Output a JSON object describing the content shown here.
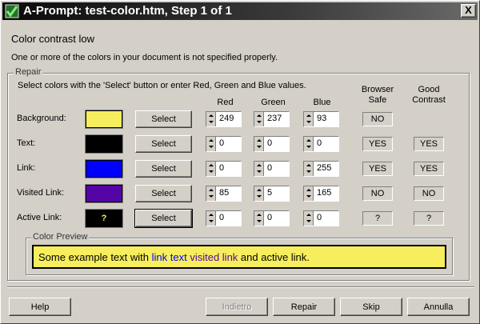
{
  "window": {
    "title": "A-Prompt: test-color.htm, Step 1 of 1",
    "close_glyph": "X"
  },
  "heading": "Color contrast low",
  "subtext": "One or more of the colors in your document is not specified properly.",
  "repair_group": {
    "label": "Repair",
    "instruction": "Select colors with the 'Select' button or enter Red, Green and Blue values.",
    "columns": {
      "red": "Red",
      "green": "Green",
      "blue": "Blue",
      "browser_safe": "Browser Safe",
      "good_contrast": "Good Contrast"
    },
    "rows": [
      {
        "label": "Background:",
        "swatch_color": "#f7ee5d",
        "swatch_text": "",
        "select_label": "Select",
        "red": "249",
        "green": "237",
        "blue": "93",
        "browser_safe": "NO",
        "good_contrast": ""
      },
      {
        "label": "Text:",
        "swatch_color": "#000000",
        "swatch_text": "",
        "select_label": "Select",
        "red": "0",
        "green": "0",
        "blue": "0",
        "browser_safe": "YES",
        "good_contrast": "YES"
      },
      {
        "label": "Link:",
        "swatch_color": "#0000ff",
        "swatch_text": "",
        "select_label": "Select",
        "red": "0",
        "green": "0",
        "blue": "255",
        "browser_safe": "YES",
        "good_contrast": "YES"
      },
      {
        "label": "Visited Link:",
        "swatch_color": "#5505a5",
        "swatch_text": "",
        "select_label": "Select",
        "red": "85",
        "green": "5",
        "blue": "165",
        "browser_safe": "NO",
        "good_contrast": "NO"
      },
      {
        "label": "Active Link:",
        "swatch_color": "#000000",
        "swatch_text": "?",
        "select_label": "Select",
        "red": "0",
        "green": "0",
        "blue": "0",
        "browser_safe": "?",
        "good_contrast": "?"
      }
    ]
  },
  "preview_group": {
    "label": "Color Preview",
    "background": "#f7ee5d",
    "text_before": "Some example text with ",
    "link_text": "link text",
    "space1": " ",
    "visited_text": "visited link",
    "text_after": " and active link.",
    "text_color": "#000000",
    "link_color": "#0000ff",
    "visited_color": "#5505a5"
  },
  "buttons": {
    "help": "Help",
    "previous": "Indietro",
    "repair": "Repair",
    "skip": "Skip",
    "cancel": "Annulla"
  }
}
